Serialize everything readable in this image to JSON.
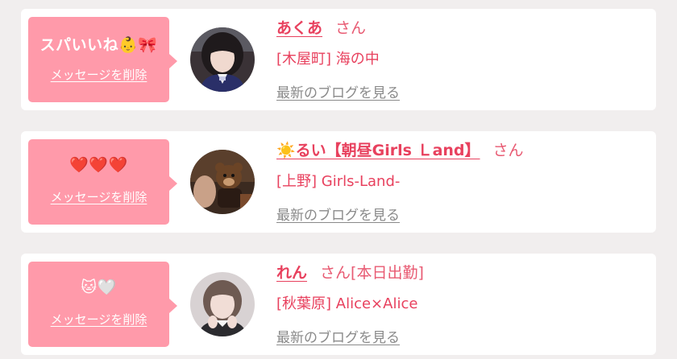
{
  "messages": [
    {
      "bubble_text": "スパいいね👶🎀",
      "delete_label": "メッセージを削除",
      "name": "あくあ",
      "honorific": "さん",
      "extra": "",
      "shop": "[木屋町] 海の中",
      "blog_link": "最新のブログを見る"
    },
    {
      "bubble_text": "❤️❤️❤️",
      "delete_label": "メッセージを削除",
      "name": "☀️るい【朝昼Girls Ｌand】",
      "honorific": "さん",
      "extra": "",
      "shop": "[上野] Girls-Land-",
      "blog_link": "最新のブログを見る"
    },
    {
      "bubble_text": "🐱🤍",
      "delete_label": "メッセージを削除",
      "name": "れん",
      "honorific": "さん",
      "extra": "[本日出勤]",
      "shop": "[秋葉原] Alice×Alice",
      "blog_link": "最新のブログを見る"
    }
  ],
  "colors": {
    "bubble": "#ff9aaa",
    "accent": "#e8415e",
    "link_gray": "#8a8a8a",
    "background": "#f1eeee"
  }
}
